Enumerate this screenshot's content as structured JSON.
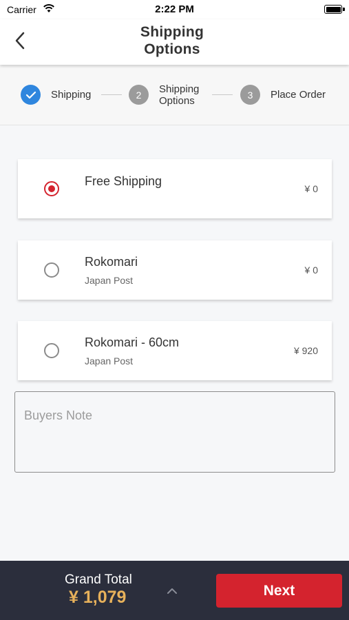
{
  "status_bar": {
    "carrier": "Carrier",
    "time": "2:22 PM"
  },
  "header": {
    "title_line1": "Shipping",
    "title_line2": "Options"
  },
  "stepper": {
    "steps": [
      {
        "number": "",
        "label": "Shipping",
        "state": "done"
      },
      {
        "number": "2",
        "label_line1": "Shipping",
        "label_line2": "Options",
        "state": "current"
      },
      {
        "number": "3",
        "label": "Place Order",
        "state": "pending"
      }
    ]
  },
  "options": [
    {
      "name": "Free Shipping",
      "carrier": "",
      "price": "¥ 0",
      "selected": true
    },
    {
      "name": "Rokomari",
      "carrier": "Japan Post",
      "price": "¥ 0",
      "selected": false
    },
    {
      "name": "Rokomari - 60cm",
      "carrier": "Japan Post",
      "price": "¥ 920",
      "selected": false
    }
  ],
  "buyers_note": {
    "placeholder": "Buyers Note",
    "value": ""
  },
  "footer": {
    "grand_total_label": "Grand Total",
    "grand_total_value": "¥ 1,079",
    "next_label": "Next"
  },
  "colors": {
    "accent_red": "#d4232e",
    "step_done_blue": "#2f86de",
    "total_gold": "#e7b15b",
    "footer_bg": "#2b2e3c"
  }
}
